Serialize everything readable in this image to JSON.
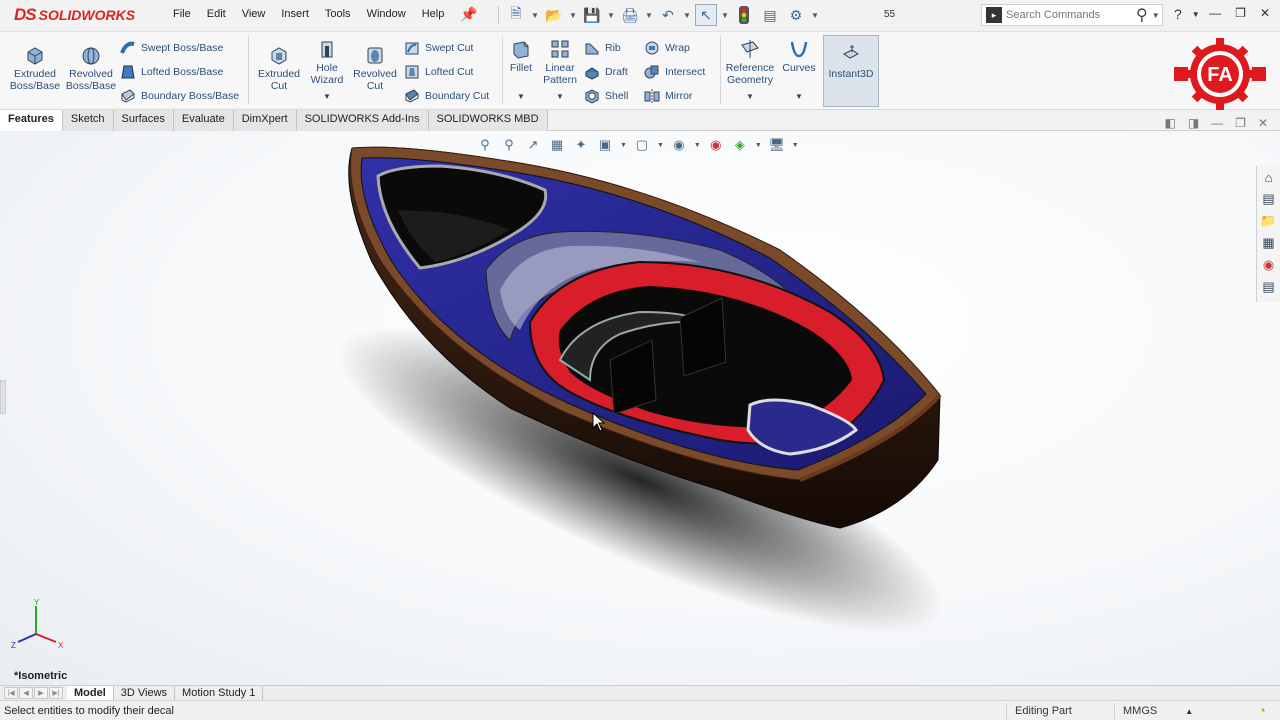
{
  "app": {
    "logo_ds": "DS",
    "logo_text": "SOLIDWORKS"
  },
  "menu": [
    "File",
    "Edit",
    "View",
    "Insert",
    "Tools",
    "Window",
    "Help"
  ],
  "doc_number": "55",
  "search": {
    "placeholder": "Search Commands"
  },
  "features_toolbar": {
    "extruded_boss": "Extruded Boss/Base",
    "revolved_boss": "Revolved Boss/Base",
    "swept_boss": "Swept Boss/Base",
    "lofted_boss": "Lofted Boss/Base",
    "boundary_boss": "Boundary Boss/Base",
    "extruded_cut": "Extruded Cut",
    "hole_wizard": "Hole Wizard",
    "revolved_cut": "Revolved Cut",
    "swept_cut": "Swept Cut",
    "lofted_cut": "Lofted Cut",
    "boundary_cut": "Boundary Cut",
    "fillet": "Fillet",
    "linear_pattern": "Linear Pattern",
    "rib": "Rib",
    "draft": "Draft",
    "shell": "Shell",
    "wrap": "Wrap",
    "intersect": "Intersect",
    "mirror": "Mirror",
    "reference_geometry": "Reference Geometry",
    "curves": "Curves",
    "instant3d": "Instant3D"
  },
  "brand_logo": {
    "text": "FA",
    "color": "#e0191f"
  },
  "tabs": [
    "Features",
    "Sketch",
    "Surfaces",
    "Evaluate",
    "DimXpert",
    "SOLIDWORKS Add-Ins",
    "SOLIDWORKS MBD"
  ],
  "active_tab": "Features",
  "view": {
    "orientation": "*Isometric"
  },
  "triad": {
    "x": "X",
    "y": "Y",
    "z": "Z"
  },
  "bottom_tabs": [
    "Model",
    "3D Views",
    "Motion Study 1"
  ],
  "status": {
    "message": "Select entities to modify their decal",
    "mode": "Editing Part",
    "units": "MMGS"
  },
  "model_colors": {
    "hull": "#3b1f12",
    "deck_trim": "#7a4a2a",
    "interior_blue": "#2a2a8c",
    "seat_red": "#d81e2a",
    "floor": "#0a0a0a"
  }
}
